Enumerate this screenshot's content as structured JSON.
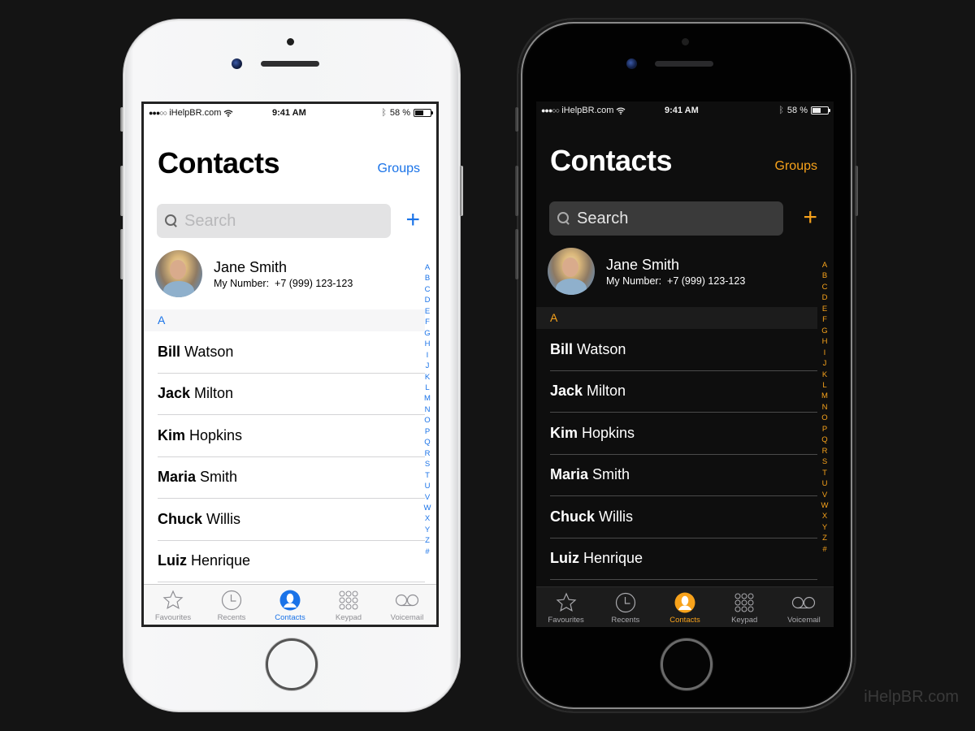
{
  "watermark": "iHelpBR.com",
  "themes": {
    "light": {
      "accent": "#1a73e8",
      "background": "#ffffff"
    },
    "dark": {
      "accent": "#f7a21b",
      "background": "#0e0e0e"
    }
  },
  "status_bar": {
    "signal": "●●●○○",
    "carrier": "iHelpBR.com",
    "wifi_icon": "wifi-icon",
    "time": "9:41 AM",
    "bluetooth_icon": "bluetooth-icon",
    "battery_text": "58 %",
    "battery_level": 0.58
  },
  "header": {
    "title": "Contacts",
    "groups_label": "Groups"
  },
  "search": {
    "placeholder": "Search",
    "icon": "search-icon"
  },
  "add_button": "+",
  "my_card": {
    "name": "Jane Smith",
    "number_label": "My Number:",
    "number": "+7 (999) 123-123"
  },
  "section": "A",
  "contacts": [
    {
      "first": "Bill",
      "last": "Watson"
    },
    {
      "first": "Jack",
      "last": "Milton"
    },
    {
      "first": "Kim",
      "last": "Hopkins"
    },
    {
      "first": "Maria",
      "last": "Smith"
    },
    {
      "first": "Chuck",
      "last": "Willis"
    },
    {
      "first": "Luiz",
      "last": "Henrique"
    }
  ],
  "index": [
    "A",
    "B",
    "C",
    "D",
    "E",
    "F",
    "G",
    "H",
    "I",
    "J",
    "K",
    "L",
    "M",
    "N",
    "O",
    "P",
    "Q",
    "R",
    "S",
    "T",
    "U",
    "V",
    "W",
    "X",
    "Y",
    "Z",
    "#"
  ],
  "tabs": [
    {
      "label": "Favourites",
      "icon": "star-icon",
      "active": false
    },
    {
      "label": "Recents",
      "icon": "clock-icon",
      "active": false
    },
    {
      "label": "Contacts",
      "icon": "person-icon",
      "active": true
    },
    {
      "label": "Keypad",
      "icon": "keypad-icon",
      "active": false
    },
    {
      "label": "Voicemail",
      "icon": "voicemail-icon",
      "active": false
    }
  ]
}
